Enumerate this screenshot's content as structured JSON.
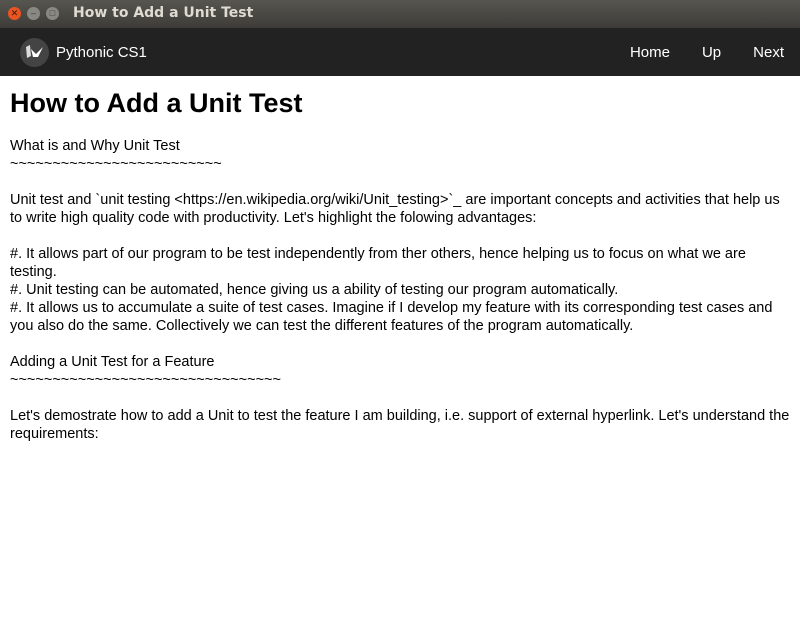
{
  "window": {
    "title": "How to Add a Unit Test"
  },
  "navbar": {
    "brand": "Pythonic CS1",
    "links": [
      "Home",
      "Up",
      "Next"
    ]
  },
  "page": {
    "heading": "How to Add a Unit Test",
    "lines": [
      "What is and Why Unit Test",
      "~~~~~~~~~~~~~~~~~~~~~~~~~",
      "",
      "Unit test and `unit testing <https://en.wikipedia.org/wiki/Unit_testing>`_ are important concepts and activities that help us to write high quality code with productivity. Let's highlight the folowing advantages:",
      "",
      "#. It allows part of our program to be test independently from ther others, hence helping us to focus on what we are testing.",
      "#. Unit testing can be automated, hence giving us a ability of testing our program automatically.",
      "#. It allows us to accumulate a suite of test cases. Imagine if I develop my feature with its corresponding test cases and you also do the same. Collectively we can test the different features of the program automatically.",
      "",
      "Adding a Unit Test for a Feature",
      "~~~~~~~~~~~~~~~~~~~~~~~~~~~~~~~~",
      "",
      "Let's demostrate how to add a Unit to test the feature I am building, i.e. support of external hyperlink. Let's understand the requirements:"
    ]
  }
}
